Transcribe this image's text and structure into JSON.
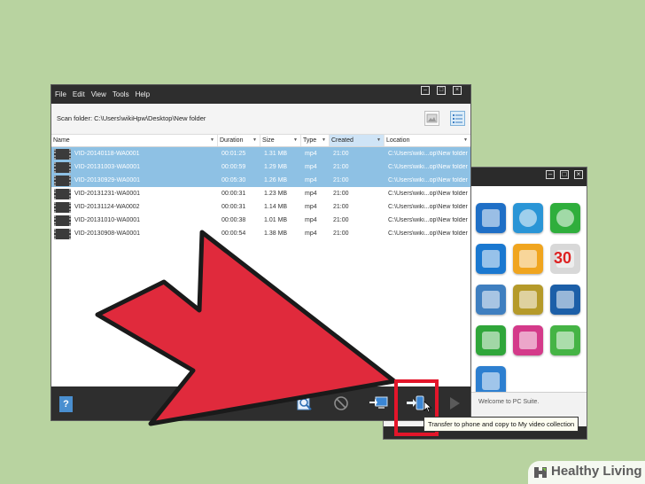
{
  "main_window": {
    "menu": [
      "File",
      "Edit",
      "View",
      "Tools",
      "Help"
    ],
    "scan_folder": "Scan folder: C:\\Users\\wikiHpw\\Desktop\\New folder",
    "columns": {
      "name": "Name",
      "duration": "Duration",
      "size": "Size",
      "type": "Type",
      "created": "Created",
      "location": "Location"
    },
    "files": [
      {
        "name": "VID-20140118-WA0001",
        "duration": "00:01:25",
        "size": "1.31 MB",
        "type": "mp4",
        "created": "21:00",
        "location": "C:\\Users\\wiki...op\\New folder",
        "selected": true
      },
      {
        "name": "VID-20131003-WA0001",
        "duration": "00:00:59",
        "size": "1.29 MB",
        "type": "mp4",
        "created": "21:00",
        "location": "C:\\Users\\wiki...op\\New folder",
        "selected": true
      },
      {
        "name": "VID-20130929-WA0001",
        "duration": "00:05:30",
        "size": "1.26 MB",
        "type": "mp4",
        "created": "21:00",
        "location": "C:\\Users\\wiki...op\\New folder",
        "selected": true
      },
      {
        "name": "VID-20131231-WA0001",
        "duration": "00:00:31",
        "size": "1.23 MB",
        "type": "mp4",
        "created": "21:00",
        "location": "C:\\Users\\wiki...op\\New folder",
        "selected": false
      },
      {
        "name": "VID-20131124-WA0002",
        "duration": "00:00:31",
        "size": "1.14 MB",
        "type": "mp4",
        "created": "21:00",
        "location": "C:\\Users\\wiki...op\\New folder",
        "selected": false
      },
      {
        "name": "VID-20131010-WA0001",
        "duration": "00:00:38",
        "size": "1.01 MB",
        "type": "mp4",
        "created": "21:00",
        "location": "C:\\Users\\wiki...op\\New folder",
        "selected": false
      },
      {
        "name": "VID-20130908-WA0001",
        "duration": "00:00:54",
        "size": "1.38 MB",
        "type": "mp4",
        "created": "21:00",
        "location": "C:\\Users\\wiki...op\\New folder",
        "selected": false
      }
    ],
    "help_label": "?",
    "tooltip": "Transfer to phone and copy to My video collection"
  },
  "suite_window": {
    "status": "Welcome to PC Suite.",
    "apps": [
      {
        "icon": "network-icon",
        "color": "#1f6fc6"
      },
      {
        "icon": "sync-icon",
        "color": "#2a95d6"
      },
      {
        "icon": "internet-icon",
        "color": "#2fae3c"
      },
      {
        "icon": "phone-icon",
        "color": "#1a78d0"
      },
      {
        "icon": "messages-icon",
        "color": "#f0a51f"
      },
      {
        "icon": "calendar-icon",
        "color": "#d8d8d8"
      },
      {
        "icon": "file-manager-icon",
        "color": "#3f7fc0"
      },
      {
        "icon": "image-store-icon",
        "color": "#b59a2a"
      },
      {
        "icon": "video-icon",
        "color": "#1c5fa8"
      },
      {
        "icon": "software-install-icon",
        "color": "#2fa63a"
      },
      {
        "icon": "music-icon",
        "color": "#d43a8a"
      },
      {
        "icon": "online-update-icon",
        "color": "#45b445"
      },
      {
        "icon": "media-icon",
        "color": "#2d7fd0"
      }
    ],
    "calendar_number": "30"
  },
  "colors": {
    "highlight": "#e3152a",
    "selection": "#8ec1e4",
    "accent_blue": "#4a8fd0"
  },
  "watermark": {
    "text": "Healthy Living"
  }
}
